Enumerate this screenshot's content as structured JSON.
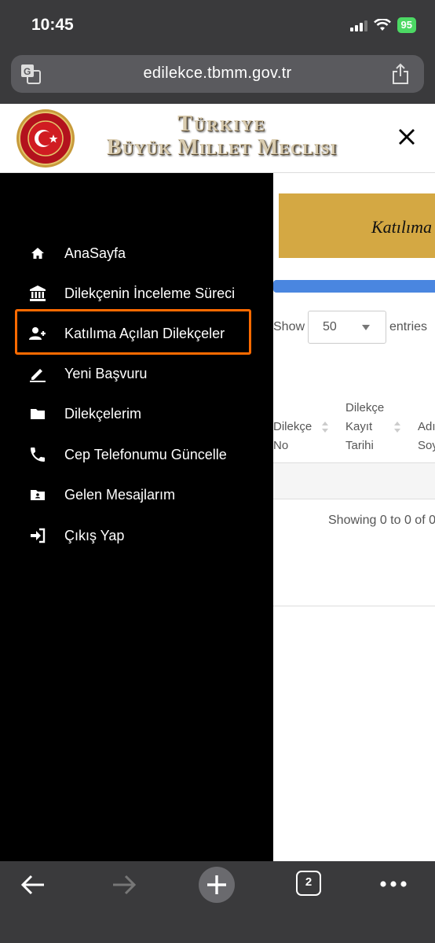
{
  "status_bar": {
    "time": "10:45",
    "battery": "95"
  },
  "browser": {
    "url": "edilekce.tbmm.gov.tr",
    "tab_count": "2"
  },
  "site": {
    "title_line1": "Türkiye",
    "title_line2": "Büyük Millet Meclisi"
  },
  "page": {
    "banner_text": "Katılıma",
    "show_label": "Show",
    "show_value": "50",
    "entries_label": "entries",
    "columns": [
      {
        "label_line1": "Dilekçe",
        "label_line2": "No",
        "label_line3": ""
      },
      {
        "label_line1": "Dilekçe",
        "label_line2": "Kayıt",
        "label_line3": "Tarihi"
      },
      {
        "label_line1": "Adı",
        "label_line2": "Soy",
        "label_line3": ""
      }
    ],
    "showing_text": "Showing 0 to 0 of 0"
  },
  "menu": {
    "items": [
      {
        "label": "AnaSayfa",
        "icon": "home-icon"
      },
      {
        "label": "Dilekçenin İnceleme Süreci",
        "icon": "institution-icon"
      },
      {
        "label": "Katılıma Açılan Dilekçeler",
        "icon": "user-plus-icon",
        "highlighted": true
      },
      {
        "label": "Yeni Başvuru",
        "icon": "pencil-icon"
      },
      {
        "label": "Dilekçelerim",
        "icon": "folder-icon"
      },
      {
        "label": "Cep Telefonumu Güncelle",
        "icon": "phone-icon"
      },
      {
        "label": "Gelen Mesajlarım",
        "icon": "message-folder-icon"
      },
      {
        "label": "Çıkış Yap",
        "icon": "sign-in-icon"
      }
    ]
  },
  "colors": {
    "highlight": "#ff6a00",
    "banner": "#d4a843",
    "progress": "#4a86e0"
  }
}
